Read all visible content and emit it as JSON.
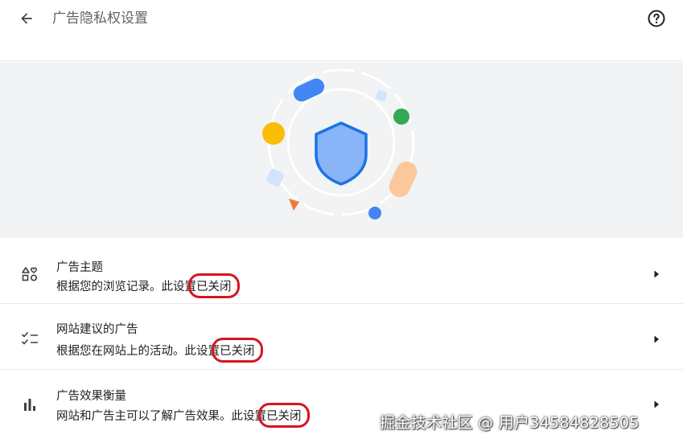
{
  "header": {
    "title": "广告隐私权设置",
    "back_icon": "arrow-back-icon",
    "help_icon": "help-circle-icon"
  },
  "hero": {
    "illustration": "privacy-shield-illustration",
    "colors": {
      "background": "#f1f3f4",
      "shield_fill": "#8ab4f8",
      "shield_stroke": "#1a73e8",
      "blue": "#4285f4",
      "green": "#34a853",
      "yellow": "#fbbc04",
      "peach": "#fcc89b",
      "orange": "#f07b3f",
      "light_blue": "#d2e3fc"
    }
  },
  "settings": [
    {
      "title": "广告主题",
      "desc_prefix": "根据您的浏览记录。此设置",
      "state": "已关闭",
      "icon": "shapes-icon"
    },
    {
      "title": "网站建议的广告",
      "desc_prefix": "根据您在网站上的活动。此设置",
      "state": "已关闭",
      "icon": "checklist-icon"
    },
    {
      "title": "广告效果衡量",
      "desc_prefix": "网站和广告主可以了解广告效果。此设置",
      "state": "已关闭",
      "icon": "bar-chart-icon"
    }
  ],
  "watermark": "掘金技术社区 @ 用户34584828505",
  "accent_colors": {
    "annotation_red": "#d6151f"
  }
}
